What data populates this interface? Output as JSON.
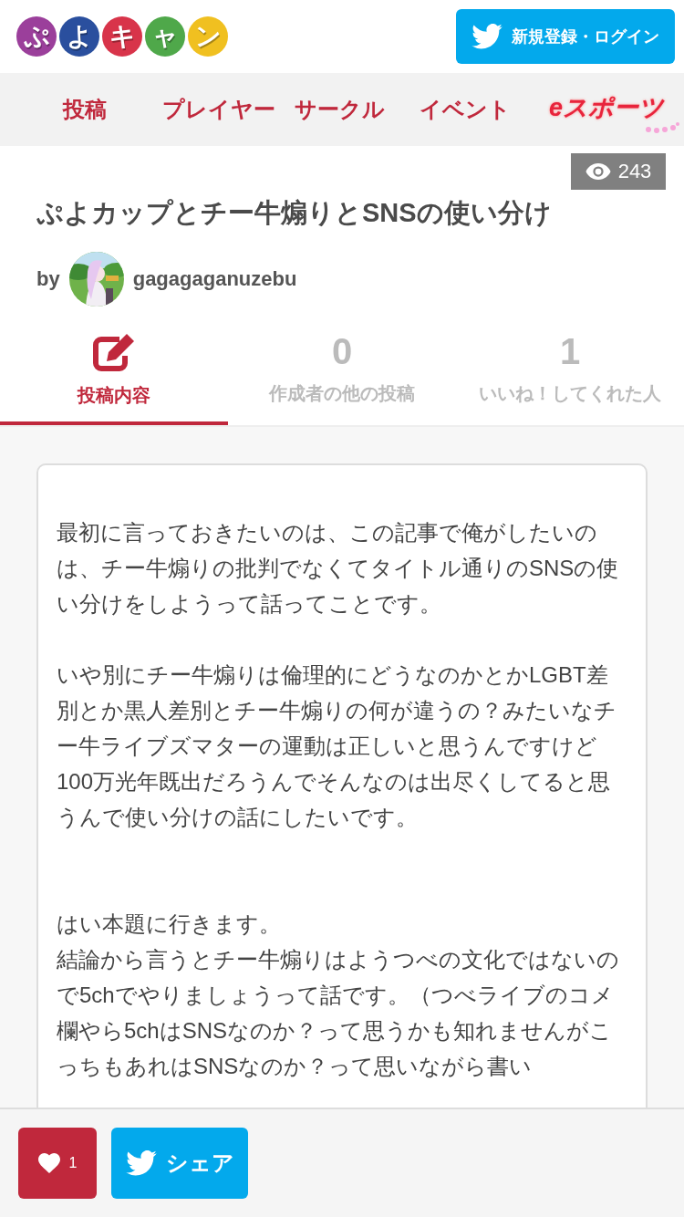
{
  "header": {
    "logo": [
      {
        "char": "ぷ",
        "color": "#9b3f9b"
      },
      {
        "char": "よ",
        "color": "#2a4f9e"
      },
      {
        "char": "キ",
        "color": "#d8344a"
      },
      {
        "char": "ャ",
        "color": "#4fa84a"
      },
      {
        "char": "ン",
        "color": "#f0c020"
      }
    ],
    "login_button": "新規登録・ログイン"
  },
  "nav": {
    "items": [
      {
        "label": "投稿",
        "kind": "text"
      },
      {
        "label": "プレイヤー",
        "kind": "text"
      },
      {
        "label": "サークル",
        "kind": "text"
      },
      {
        "label": "イベント",
        "kind": "text"
      },
      {
        "label": "eスポーツ",
        "kind": "logo"
      }
    ]
  },
  "post": {
    "views": "243",
    "title": "ぷよカップとチー牛煽りとSNSの使い分け",
    "by": "by",
    "author": "gagagaganuzebu"
  },
  "tabs": [
    {
      "kind": "icon",
      "label": "投稿内容",
      "selected": true
    },
    {
      "kind": "count",
      "count": "0",
      "label": "作成者の他の投稿",
      "selected": false
    },
    {
      "kind": "count",
      "count": "1",
      "label": "いいね！してくれた人",
      "selected": false
    }
  ],
  "body": [
    "最初に言っておきたいのは、この記事で俺がしたいのは、チー牛煽りの批判でなくてタイトル通りのSNSの使い分けをしようって話ってことです。",
    "いや別にチー牛煽りは倫理的にどうなのかとかLGBT差別とか黒人差別とチー牛煽りの何が違うの？みたいなチー牛ライブズマターの運動は正しいと思うんですけど100万光年既出だろうんでそんなのは出尽くしてると思うんで使い分けの話にしたいです。",
    "はい本題に行きます。",
    "結論から言うとチー牛煽りはようつべの文化ではないので5chでやりましょうって話です。（つべライブのコメ欄やら5chはSNSなのか？って思うかも知れませんがこっちもあれはSNSなのか？って思いながら書い"
  ],
  "footer": {
    "like_count": "1",
    "share": "シェア"
  }
}
